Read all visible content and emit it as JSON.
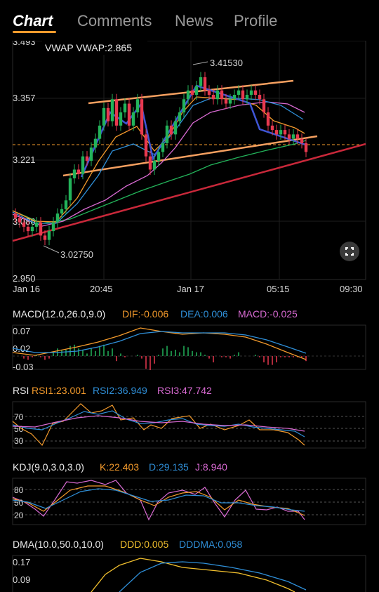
{
  "tabs": [
    {
      "label": "Chart",
      "active": true
    },
    {
      "label": "Comments",
      "active": false
    },
    {
      "label": "News",
      "active": false
    },
    {
      "label": "Profile",
      "active": false
    }
  ],
  "main": {
    "vwap_label": "VWAP VWAP:2.865",
    "price_ticks": [
      "3.493",
      "3.357",
      "3.221",
      "3.086",
      "2.950"
    ],
    "high_marker": "3.41530",
    "low_marker": "3.02750",
    "time_ticks": [
      "Jan 16",
      "20:45",
      "Jan 17",
      "05:15",
      "09:30"
    ],
    "fullscreen_icon": "expand-icon"
  },
  "macd": {
    "name": "MACD(12.0,26.0,9.0)",
    "dif": "DIF:-0.006",
    "dea": "DEA:0.006",
    "macd": "MACD:-0.025",
    "ticks": [
      "0.07",
      "0.02",
      "-0.03"
    ]
  },
  "rsi": {
    "name": "RSI",
    "rsi1": "RSI1:23.001",
    "rsi2": "RSI2:36.949",
    "rsi3": "RSI3:47.742",
    "ticks": [
      "70",
      "50",
      "30"
    ]
  },
  "kdj": {
    "name": "KDJ(9.0,3.0,3.0)",
    "k": "K:22.403",
    "d": "D:29.135",
    "j": "J:8.940",
    "ticks": [
      "80",
      "50",
      "20"
    ]
  },
  "dma": {
    "name": "DMA(10.0,50.0,10.0)",
    "ddd": "DDD:0.005",
    "dddma": "DDDMA:0.058",
    "ticks": [
      "0.17",
      "0.09"
    ]
  },
  "colors": {
    "up": "#23b35a",
    "down": "#e8394f",
    "orange": "#f39a2c",
    "blue": "#2f8fd8",
    "pink": "#d86ad2",
    "yellow": "#f2c02e",
    "trend": "#c9283a",
    "channel": "#f6a060"
  },
  "chart_data": {
    "type": "candlestick",
    "x_ticks": [
      "Jan 16",
      "20:45",
      "Jan 17",
      "05:15",
      "09:30"
    ],
    "ylim": [
      2.95,
      3.493
    ],
    "y_ticks": [
      3.493,
      3.357,
      3.221,
      3.086,
      2.95
    ],
    "high": 3.4153,
    "low": 3.0275,
    "vwap": 2.865,
    "close": [
      3.09,
      3.08,
      3.07,
      3.06,
      3.07,
      3.08,
      3.05,
      3.04,
      3.06,
      3.08,
      3.1,
      3.11,
      3.13,
      3.18,
      3.2,
      3.19,
      3.23,
      3.22,
      3.25,
      3.27,
      3.3,
      3.34,
      3.31,
      3.36,
      3.3,
      3.33,
      3.35,
      3.3,
      3.33,
      3.36,
      3.28,
      3.23,
      3.2,
      3.22,
      3.24,
      3.26,
      3.3,
      3.28,
      3.31,
      3.33,
      3.36,
      3.38,
      3.37,
      3.39,
      3.41,
      3.38,
      3.37,
      3.36,
      3.38,
      3.36,
      3.35,
      3.36,
      3.37,
      3.38,
      3.36,
      3.37,
      3.38,
      3.37,
      3.36,
      3.33,
      3.3,
      3.29,
      3.28,
      3.29,
      3.28,
      3.27,
      3.28,
      3.27,
      3.26,
      3.24
    ],
    "macd": {
      "dif": -0.006,
      "dea": 0.006,
      "macd": -0.025
    },
    "rsi": {
      "rsi1": 23.001,
      "rsi2": 36.949,
      "rsi3": 47.742
    },
    "kdj": {
      "k": 22.403,
      "d": 29.135,
      "j": 8.94
    },
    "dma": {
      "ddd": 0.005,
      "dddma": 0.058
    }
  }
}
